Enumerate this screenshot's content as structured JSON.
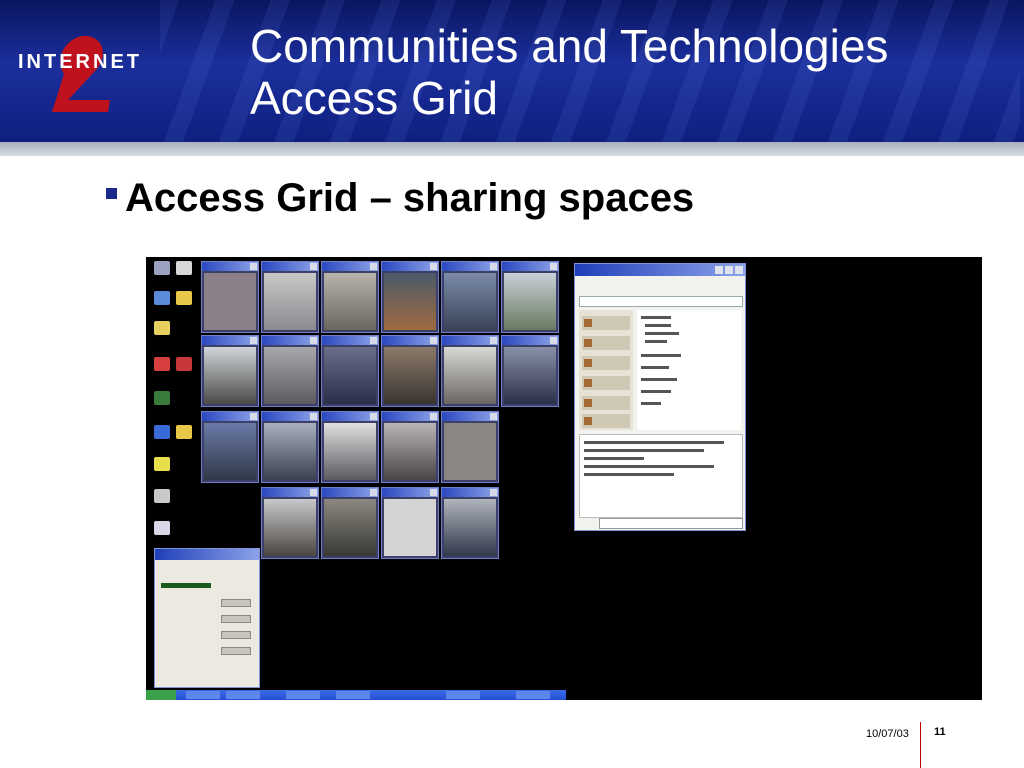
{
  "header": {
    "title_line1": "Communities and Technologies",
    "title_line2": "Access Grid",
    "logo_text": "INTERNET",
    "logo_numeral": "2"
  },
  "body": {
    "bullet": "Access Grid – sharing spaces"
  },
  "screenshot": {
    "description_icon": "access-grid-desktop-screenshot"
  },
  "footer": {
    "date": "10/07/03",
    "page_number": "11"
  },
  "colors": {
    "header_bg": "#1b2f9c",
    "bullet": "#1a2a8a",
    "footer_rule": "#c00000"
  }
}
